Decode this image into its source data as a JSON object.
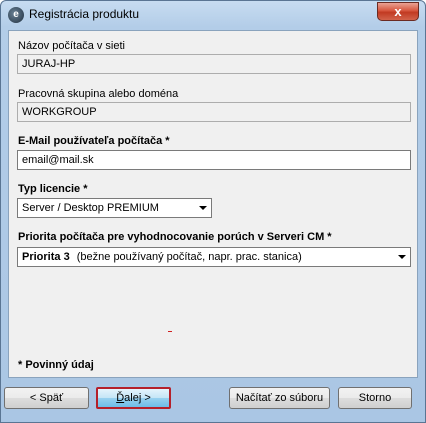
{
  "window": {
    "title": "Registrácia produktu",
    "close_glyph": "x"
  },
  "computer_name": {
    "label": "Názov počítača v sieti",
    "value": "JURAJ-HP"
  },
  "workgroup": {
    "label": "Pracovná skupina alebo doména",
    "value": "WORKGROUP"
  },
  "email": {
    "label": "E-Mail používateľa počítača *",
    "value": "email@mail.sk"
  },
  "license": {
    "label": "Typ licencie *",
    "selected": "Server / Desktop PREMIUM"
  },
  "priority": {
    "label": "Priorita počítača pre vyhodnocovanie porúch v Serveri CM *",
    "selected_bold": "Priorita 3",
    "selected_desc": "(bežne používaný počítač, napr. prac. stanica)"
  },
  "required_note": "* Povinný údaj",
  "buttons": {
    "back": "<  Späť",
    "next_letter": "Ď",
    "next_rest": "alej  >",
    "load": "Načítať zo súboru",
    "cancel": "Storno"
  }
}
